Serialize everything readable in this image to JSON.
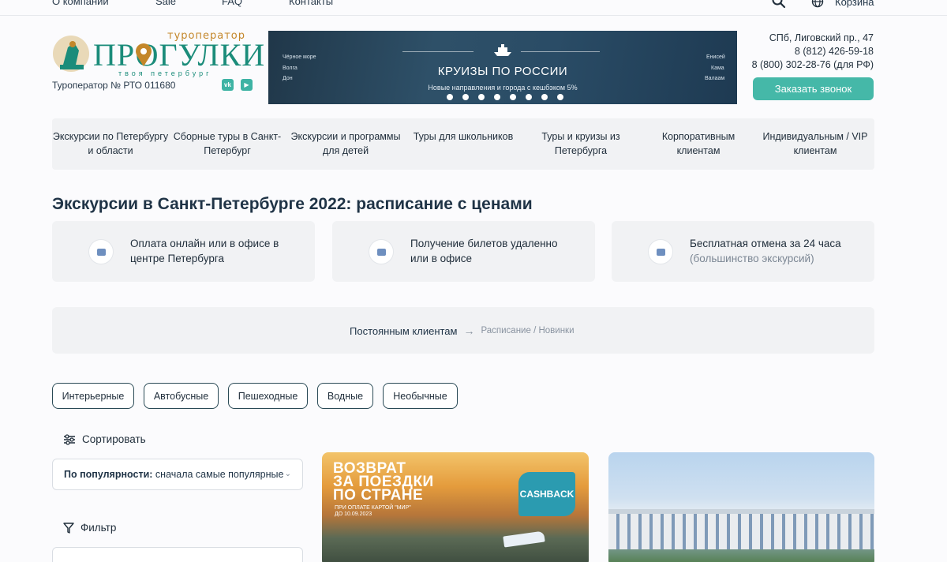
{
  "topnav": {
    "links": [
      "О компании",
      "Sale",
      "FAQ",
      "Контакты"
    ],
    "cart_label": "Корзина"
  },
  "logo": {
    "tagline": "туроператор",
    "word": "ПРОГУЛКИ",
    "sub": "твоя петербург"
  },
  "license": "Туроператор  № РТО 011680",
  "social": [
    "vk-icon",
    "youtube-icon"
  ],
  "banner": {
    "title": "КРУИЗЫ ПО РОССИИ",
    "subtitle": "Новые направления и города с кешбэком 5%",
    "cities_left": [
      "Чёрное море",
      "Волга",
      "Дон"
    ],
    "cities_right": [
      "Енисей",
      "Кама",
      "Валаам"
    ],
    "dot_count": 8
  },
  "contacts": {
    "address": "СПб, Лиговский пр., 47",
    "phone1": "8 (812) 426-59-18",
    "phone2": "8 (800) 302-28-76 (для РФ)",
    "callback_label": "Заказать звонок"
  },
  "menu": [
    "Экскурсии по Петербургу и области",
    "Сборные туры в Санкт-Петербург",
    "Экскурсии и программы для детей",
    "Туры для школьников",
    "Туры и круизы из Петербурга",
    "Корпоративным клиентам",
    "Индивидуальным / VIP клиентам"
  ],
  "heading": "Экскурсии в Санкт-Петербурге 2022: расписание с ценами",
  "features": [
    {
      "line1": "Оплата онлайн или в офисе в",
      "line2": "центре Петербурга",
      "icon": "wallet-icon"
    },
    {
      "line1": "Получение билетов удаленно",
      "line2": "или в офисе",
      "icon": "ticket-icon"
    },
    {
      "line1": "Бесплатная отмена за 24 часа",
      "line2": "(большинство экскурсий)",
      "icon": "hourglass-icon"
    }
  ],
  "crumbs": {
    "main": "Постоянным клиентам",
    "arrow": "→",
    "rest": "Расписание / Новинки"
  },
  "tags": [
    "Интерьерные",
    "Автобусные",
    "Пешеходные",
    "Водные",
    "Необычные"
  ],
  "sort": {
    "label": "Сортировать",
    "value_bold": "По популярности:",
    "value": "сначала самые популярные"
  },
  "filter": {
    "label": "Фильтр"
  },
  "cards": {
    "promo_title": [
      "ВОЗВРАТ",
      "ЗА ПОЕЗДКИ",
      "ПО СТРАНЕ"
    ],
    "promo_sub": [
      "ПРИ ОПЛАТЕ КАРТОЙ \"МИР\"",
      "ДО 10.09.2023"
    ],
    "cashback": "CASHBACK"
  }
}
